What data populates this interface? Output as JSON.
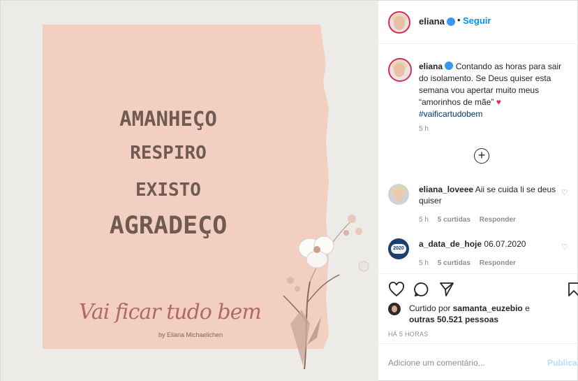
{
  "image": {
    "lines": [
      "AMANHEÇO",
      "RESPIRO",
      "EXISTO",
      "AGRADEÇO"
    ],
    "script_text": "Vai ficar tudo bem",
    "byline": "by Eliana Michaelichen"
  },
  "header": {
    "username": "eliana",
    "dot": "•",
    "follow_label": "Seguir"
  },
  "caption": {
    "username": "eliana",
    "text": "Contando as horas para sair do isolamento. Se Deus quiser esta semana vou apertar muito meus “amorinhos de mãe”",
    "hashtag": "#vaificartudobem",
    "time": "5 h"
  },
  "comments": [
    {
      "username": "eliana_loveee",
      "text": "Aii se cuida li se deus quiser",
      "time": "5 h",
      "likes": "5 curtidas",
      "reply": "Responder"
    },
    {
      "username": "a_data_de_hoje",
      "text": "06.07.2020",
      "time": "5 h",
      "likes": "5 curtidas",
      "reply": "Responder",
      "badge": "2020"
    }
  ],
  "likes": {
    "prefix": "Curtido por",
    "user": "samanta_euzebio",
    "middle": "e",
    "others": "outras 50.521 pessoas"
  },
  "posted_time": "HÁ 5 HORAS",
  "add_comment": {
    "placeholder": "Adicione um comentário...",
    "publish_label": "Publicar"
  },
  "icons": [
    "verified-icon",
    "heart-icon",
    "comment-icon",
    "share-icon",
    "save-icon",
    "plus-circle-icon"
  ],
  "colors": {
    "link": "#0095f6",
    "publish_disabled": "#b2dffc",
    "story_ring": "#d62d57",
    "paper": "#f2cfc0"
  }
}
